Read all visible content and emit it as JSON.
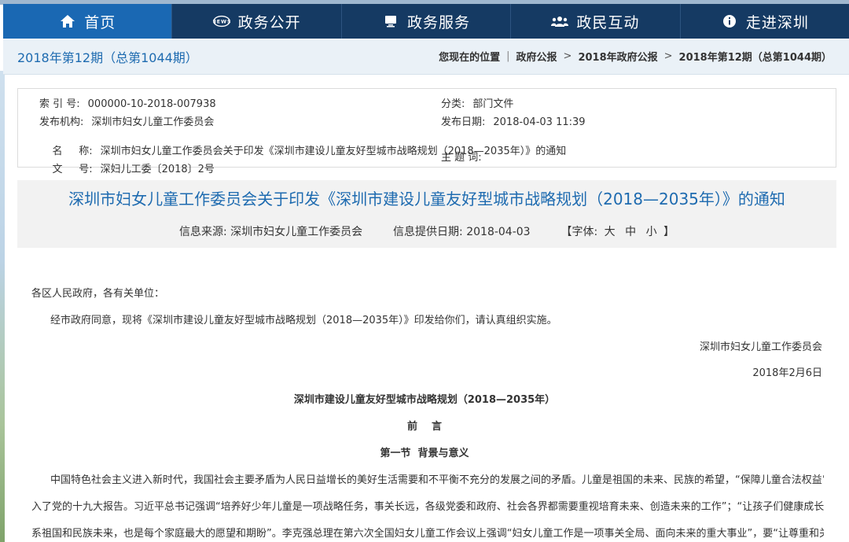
{
  "nav": {
    "items": [
      {
        "label": "首页",
        "icon": "home-icon"
      },
      {
        "label": "政务公开",
        "icon": "news-icon"
      },
      {
        "label": "政务服务",
        "icon": "monitor-icon"
      },
      {
        "label": "政民互动",
        "icon": "users-icon"
      },
      {
        "label": "走进深圳",
        "icon": "info-icon"
      }
    ],
    "active_color": "#1a68b3",
    "bg_color": "#153a63"
  },
  "breadcrumb": {
    "issue_title": "2018年第12期（总第1044期）",
    "location_label": "您现在的位置",
    "items": [
      "政府公报",
      "2018年政府公报",
      "2018年第12期（总第1044期）"
    ]
  },
  "meta": {
    "index_label": "索 引 号:",
    "index_value": "000000-10-2018-007938",
    "category_label": "分类:",
    "category_value": "部门文件",
    "publisher_label": "发布机构:",
    "publisher_value": "深圳市妇女儿童工作委员会",
    "date_label": "发布日期:",
    "date_value": "2018-04-03 11:39",
    "name_label": "名     称:",
    "name_value": "深圳市妇女儿童工作委员会关于印发《深圳市建设儿童友好型城市战略规划（2018—2035年）》的通知",
    "docno_label": "文     号:",
    "docno_value": "深妇儿工委〔2018〕2号",
    "subject_label": "主 题 词:",
    "subject_value": ""
  },
  "title_area": {
    "title": "深圳市妇女儿童工作委员会关于印发《深圳市建设儿童友好型城市战略规划（2018—2035年）》的通知",
    "source_label": "信息来源:",
    "source_value": "深圳市妇女儿童工作委员会",
    "date_label": "信息提供日期:",
    "date_value": "2018-04-03",
    "font_label": "【字体:",
    "font_large": "大",
    "font_medium": "中",
    "font_small": "小",
    "font_end": "】"
  },
  "body": {
    "salutation": "各区人民政府，各有关单位：",
    "p1": "经市政府同意，现将《深圳市建设儿童友好型城市战略规划（2018—2035年）》印发给你们，请认真组织实施。",
    "signer": "深圳市妇女儿童工作委员会",
    "sign_date": "2018年2月6日",
    "doc_heading": "深圳市建设儿童友好型城市战略规划（2018—2035年）",
    "preface": "前    言",
    "section1": "第一节  背景与意义",
    "para_line1": "中国特色社会主义进入新时代，我国社会主要矛盾为人民日益增长的美好生活需要和不平衡不充分的发展之间的矛盾。儿童是祖国的未来、民族的希望，“保障儿童合法权益”纳",
    "para_line2": "入了党的十九大报告。习近平总书记强调“培养好少年儿童是一项战略任务，事关长远，各级党委和政府、社会各界都需要重视培育未来、创造未来的工作”；“让孩子们健康成长关",
    "para_line3": "系祖国和民族未来，也是每个家庭最大的愿望和期盼”。李克强总理在第六次全国妇女儿童工作会议上强调“妇女儿童工作是一项事关全局、面向未来的重大事业”，要“让尊重和关"
  }
}
